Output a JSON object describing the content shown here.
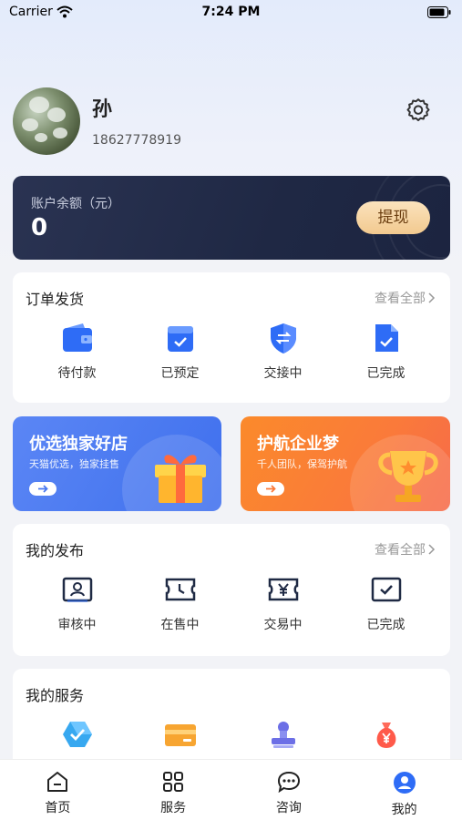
{
  "status_bar": {
    "carrier": "Carrier",
    "time": "7:24 PM"
  },
  "profile": {
    "name": "孙",
    "phone": "18627778919",
    "settings_icon": "gear-icon"
  },
  "balance": {
    "label": "账户余额（元）",
    "amount": "0",
    "withdraw_label": "提现"
  },
  "orders": {
    "title": "订单发货",
    "more": "查看全部",
    "items": [
      {
        "label": "待付款",
        "icon": "wallet-icon"
      },
      {
        "label": "已预定",
        "icon": "calendar-check-icon"
      },
      {
        "label": "交接中",
        "icon": "shield-exchange-icon"
      },
      {
        "label": "已完成",
        "icon": "document-check-icon"
      }
    ]
  },
  "promos": [
    {
      "title": "优选独家好店",
      "subtitle": "天猫优选，独家挂售",
      "icon": "gift-box-icon",
      "color": "#4f7ff3"
    },
    {
      "title": "护航企业梦",
      "subtitle": "千人团队，保驾护航",
      "icon": "trophy-icon",
      "color": "#fb7c35"
    }
  ],
  "publish": {
    "title": "我的发布",
    "more": "查看全部",
    "items": [
      {
        "label": "审核中",
        "icon": "id-card-icon"
      },
      {
        "label": "在售中",
        "icon": "clock-ticket-icon"
      },
      {
        "label": "交易中",
        "icon": "yen-ticket-icon"
      },
      {
        "label": "已完成",
        "icon": "check-box-icon"
      }
    ]
  },
  "services": {
    "title": "我的服务",
    "items": [
      {
        "icon": "verified-badge-icon"
      },
      {
        "icon": "bank-card-icon"
      },
      {
        "icon": "seal-stamp-icon"
      },
      {
        "icon": "money-bag-icon"
      }
    ]
  },
  "tabbar": {
    "items": [
      {
        "label": "首页",
        "icon": "home-icon"
      },
      {
        "label": "服务",
        "icon": "grid-icon"
      },
      {
        "label": "咨询",
        "icon": "chat-icon"
      },
      {
        "label": "我的",
        "icon": "user-icon",
        "active": true
      }
    ]
  },
  "colors": {
    "accent": "#2e6cf6",
    "balance_card": "#1f2844",
    "withdraw": "#f5cf98"
  }
}
